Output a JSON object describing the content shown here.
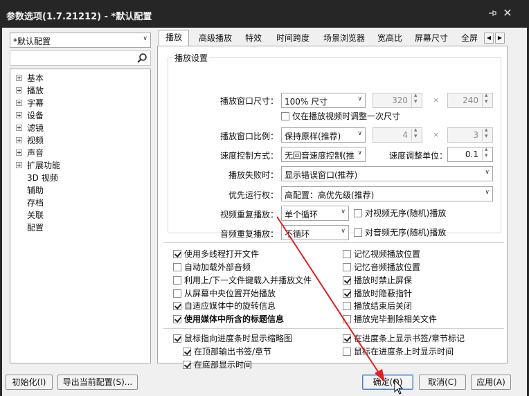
{
  "window": {
    "title": "参数选项(1.7.21212) - *默认配置"
  },
  "sidebar": {
    "profile": "*默认配置",
    "tree": [
      {
        "label": "基本",
        "expandable": true
      },
      {
        "label": "播放",
        "expandable": true
      },
      {
        "label": "字幕",
        "expandable": true
      },
      {
        "label": "设备",
        "expandable": true
      },
      {
        "label": "滤镜",
        "expandable": true
      },
      {
        "label": "视频",
        "expandable": true
      },
      {
        "label": "声音",
        "expandable": true
      },
      {
        "label": "扩展功能",
        "expandable": true
      },
      {
        "label": "3D 视频",
        "expandable": false
      },
      {
        "label": "辅助",
        "expandable": false
      },
      {
        "label": "存档",
        "expandable": false
      },
      {
        "label": "关联",
        "expandable": false
      },
      {
        "label": "配置",
        "expandable": false
      }
    ]
  },
  "tabs": [
    {
      "label": "播放",
      "active": true
    },
    {
      "label": "高级播放"
    },
    {
      "label": "特效"
    },
    {
      "label": "时间跨度"
    },
    {
      "label": "场景浏览器"
    },
    {
      "label": "宽高比"
    },
    {
      "label": "屏幕尺寸"
    },
    {
      "label": "全屏"
    }
  ],
  "group": {
    "title": "播放设置",
    "window_size_label": "播放窗口尺寸：",
    "window_size_value": "100% 尺寸",
    "width": "320",
    "height": "240",
    "times": "×",
    "only_on_start_label": "仅在播放视频时调整一次尺寸",
    "aspect_label": "播放窗口比例：",
    "aspect_value": "保持原样(推荐)",
    "aspect_w": "4",
    "aspect_h": "3",
    "speed_mode_label": "速度控制方式：",
    "speed_mode_value": "无回音速度控制(推",
    "speed_unit_label": "速度调整单位：",
    "speed_unit_value": "0.1",
    "fail_label": "播放失败时：",
    "fail_value": "显示错误窗口(推荐)",
    "priority_label": "优先运行权：",
    "priority_value": "高配置：高优先级(推荐)",
    "video_repeat_label": "视频重复播放：",
    "video_repeat_value": "单个循环",
    "video_shuffle_label": "对视频无序(随机)播放",
    "audio_repeat_label": "音频重复播放：",
    "audio_repeat_value": "不循环",
    "audio_shuffle_label": "对音频无序(随机)播放"
  },
  "options_left": [
    {
      "label": "使用多线程打开文件",
      "checked": true
    },
    {
      "label": "自动加载外部音频",
      "checked": false
    },
    {
      "label": "利用上/下一文件键载入并播放文件",
      "checked": false
    },
    {
      "label": "从屏幕中央位置开始播放",
      "checked": false
    },
    {
      "label": "自适应媒体中的旋转信息",
      "checked": true
    },
    {
      "label": "使用媒体中所含的标题信息",
      "checked": true,
      "bold": true
    }
  ],
  "options_right": [
    {
      "label": "记忆视频播放位置",
      "checked": false
    },
    {
      "label": "记忆音频播放位置",
      "checked": false
    },
    {
      "label": "播放时禁止屏保",
      "checked": true
    },
    {
      "label": "播放时隐蔽指针",
      "checked": true
    },
    {
      "label": "播放结束后关闭",
      "checked": false
    },
    {
      "label": "播放完毕删除相关文件",
      "checked": false
    }
  ],
  "seek": {
    "thumb": {
      "label": "鼠标指向进度条时显示缩略图",
      "checked": true
    },
    "top_bookmark": {
      "label": "在顶部输出书签/章节",
      "checked": true
    },
    "bottom_time": {
      "label": "在底部显示时间",
      "checked": true
    },
    "bar_bookmark": {
      "label": "在进度条上显示书签/章节标记",
      "checked": true
    },
    "bar_time": {
      "label": "鼠标在进度条上时显示时间",
      "checked": false
    }
  },
  "footer": {
    "init": "初始化(I)",
    "export": "导出当前配置(S)...",
    "ok": "确定(O)",
    "cancel": "取消(C)",
    "apply": "应用(A)"
  },
  "colors": {
    "annotation_arrow": "#e02020",
    "titlebar": "#262626",
    "default_button_border": "#4a7fc2"
  }
}
